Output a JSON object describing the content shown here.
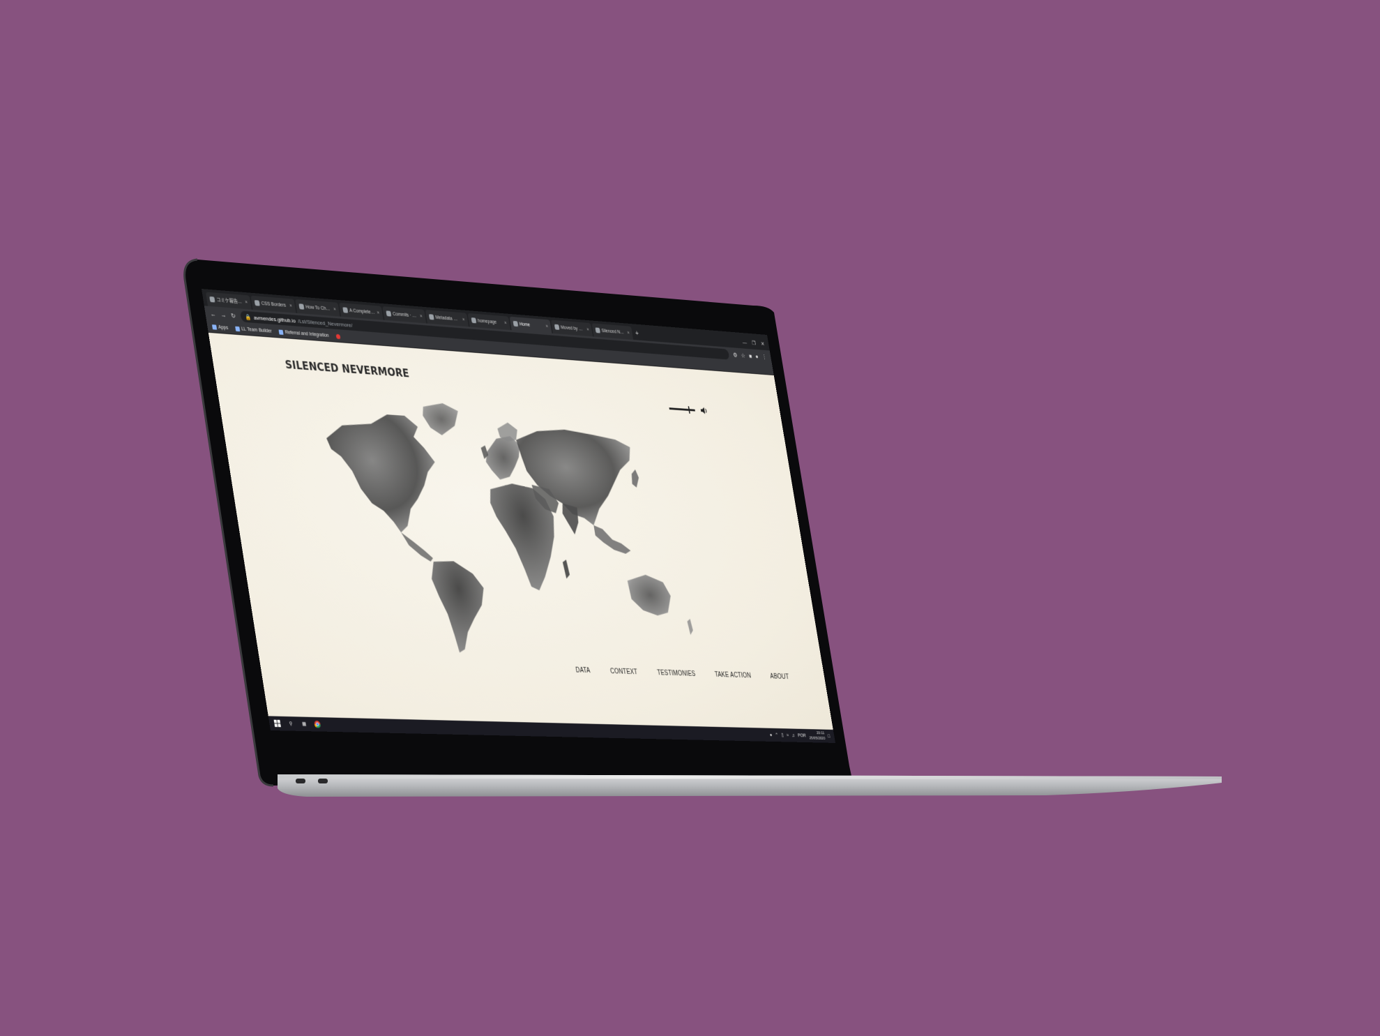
{
  "browser": {
    "tabs": [
      {
        "label": "コミケ報告 - design",
        "active": false
      },
      {
        "label": "CSS Borders",
        "active": false
      },
      {
        "label": "How To Change Im",
        "active": false
      },
      {
        "label": "A Complete Guide",
        "active": false
      },
      {
        "label": "Commits · AMend",
        "active": false
      },
      {
        "label": "Metadata Manda",
        "active": false
      },
      {
        "label": "homepage",
        "active": false
      },
      {
        "label": "Home",
        "active": true
      },
      {
        "label": "Moved by Gesti",
        "active": false
      },
      {
        "label": "Silenced Nevermo",
        "active": false
      }
    ],
    "tab_close": "×",
    "new_tab": "+",
    "window_controls": {
      "minimize": "—",
      "maximize": "❐",
      "close": "✕"
    },
    "url_host": "avmendes.github.io",
    "url_path": "/Lst/Silenced_Nevermore/",
    "bookmarks": [
      {
        "label": "Apps",
        "icon": "apps-grid-icon"
      },
      {
        "label": "LL Team Builder",
        "icon": "bookmark-icon"
      },
      {
        "label": "Referral and Integration",
        "icon": "bookmark-icon"
      },
      {
        "label": "",
        "icon": "youtube-icon"
      }
    ]
  },
  "site": {
    "title": "SILENCED NEVERMORE",
    "audio_volume": 0.75,
    "nav": [
      "DATA",
      "CONTEXT",
      "TESTIMONIES",
      "TAKE ACTION",
      "ABOUT"
    ]
  },
  "taskbar": {
    "time": "20:11",
    "date": "25/05/2020",
    "lang": "POR"
  },
  "colors": {
    "background": "#87527f",
    "page": "#f6f2e6",
    "browser_dark": "#202124",
    "taskbar": "#1b1b23"
  }
}
